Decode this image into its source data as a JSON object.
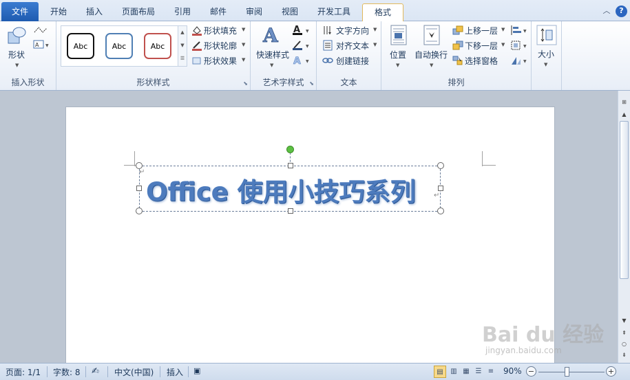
{
  "tabs": [
    "文件",
    "开始",
    "插入",
    "页面布局",
    "引用",
    "邮件",
    "审阅",
    "视图",
    "开发工具",
    "格式"
  ],
  "active_tab": "格式",
  "ribbon": {
    "insert_shapes": {
      "shapes_label": "形状",
      "group_label": "插入形状"
    },
    "shape_styles": {
      "gallery": [
        "Abc",
        "Abc",
        "Abc"
      ],
      "fill": "形状填充",
      "outline": "形状轮廓",
      "effects": "形状效果",
      "group_label": "形状样式"
    },
    "wordart_styles": {
      "quick_styles": "快速样式",
      "group_label": "艺术字样式"
    },
    "text": {
      "direction": "文字方向",
      "align": "对齐文本",
      "link": "创建链接",
      "group_label": "文本"
    },
    "arrange": {
      "position": "位置",
      "wrap": "自动换行",
      "bring_forward": "上移一层",
      "send_backward": "下移一层",
      "selection_pane": "选择窗格",
      "group_label": "排列"
    },
    "size": {
      "label": "大小"
    }
  },
  "document": {
    "wordart_text": "Office 使用小技巧系列"
  },
  "status": {
    "page": "页面: 1/1",
    "words": "字数: 8",
    "language": "中文(中国)",
    "mode": "插入",
    "zoom": "90%"
  },
  "watermark": {
    "main": "Bai du 经验",
    "sub": "jingyan.baidu.com"
  },
  "colors": {
    "file_tab": "#2b66c0",
    "active_tab_border": "#e2b95b",
    "wordart": "#4d7bbd"
  }
}
